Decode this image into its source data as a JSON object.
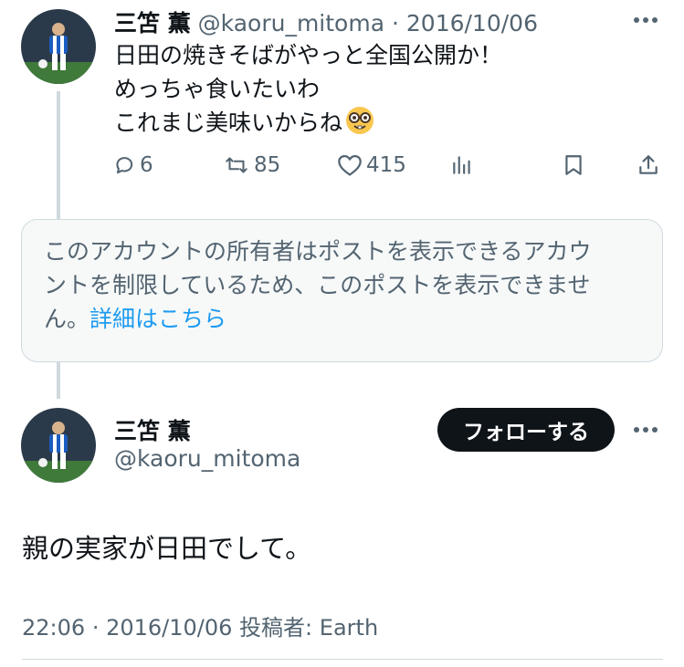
{
  "post1": {
    "display_name": "三笘 薫",
    "handle": "@kaoru_mitoma",
    "separator": "·",
    "date": "2016/10/06",
    "text_lines": [
      "日田の焼きそばがやっと全国公開か！",
      "めっちゃ食いたいわ",
      "これまじ美味いからね"
    ],
    "emoji": "nerd-face-emoji",
    "replies": "6",
    "reposts": "85",
    "likes": "415"
  },
  "notice": {
    "lines": [
      "このアカウントの所有者はポストを表示できるアカウ",
      "ントを制限しているため、このポストを表示できませ"
    ],
    "line3_prefix": "ん。",
    "link_label": "詳細はこちら"
  },
  "post2": {
    "display_name": "三笘 薫",
    "handle": "@kaoru_mitoma",
    "follow_label": "フォローする",
    "text": "親の実家が日田でして。",
    "time": "22:06",
    "separator": "·",
    "date": "2016/10/06",
    "posted_by_label": "投稿者:",
    "client": "Earth"
  },
  "colors": {
    "text": "#0f1419",
    "muted": "#536471",
    "link": "#1d9bf0",
    "border": "#cfd9de",
    "notice_bg": "#f7f9f9"
  },
  "icons": [
    "more-icon",
    "reply-icon",
    "repost-icon",
    "like-icon",
    "views-icon",
    "bookmark-icon",
    "share-icon"
  ]
}
